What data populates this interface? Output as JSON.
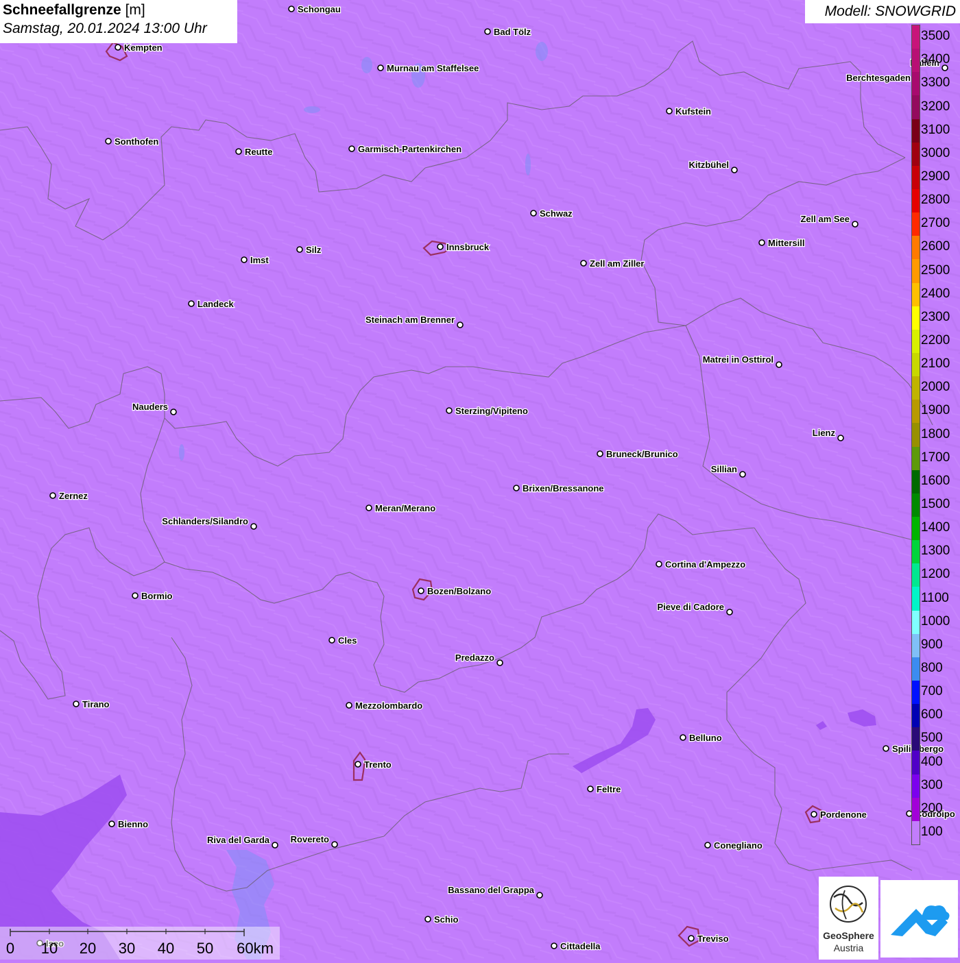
{
  "title": {
    "main": "Schneefallgrenze",
    "unit": "[m]",
    "datetime": "Samstag, 20.01.2024 13:00 Uhr"
  },
  "model_label": "Modell: SNOWGRID",
  "legend": {
    "levels": [
      {
        "value": "3500",
        "color": "#c8147a"
      },
      {
        "value": "3400",
        "color": "#b80f74"
      },
      {
        "value": "3300",
        "color": "#a80a6e"
      },
      {
        "value": "3200",
        "color": "#940a5e"
      },
      {
        "value": "3100",
        "color": "#7a0018"
      },
      {
        "value": "3000",
        "color": "#a00010"
      },
      {
        "value": "2900",
        "color": "#c80008"
      },
      {
        "value": "2800",
        "color": "#e60000"
      },
      {
        "value": "2700",
        "color": "#ff2a00"
      },
      {
        "value": "2600",
        "color": "#ff7a00"
      },
      {
        "value": "2500",
        "color": "#ff9a00"
      },
      {
        "value": "2400",
        "color": "#ffc000"
      },
      {
        "value": "2300",
        "color": "#ffff00"
      },
      {
        "value": "2200",
        "color": "#d8f000"
      },
      {
        "value": "2100",
        "color": "#c8d800"
      },
      {
        "value": "2000",
        "color": "#c0b400"
      },
      {
        "value": "1900",
        "color": "#b89a00"
      },
      {
        "value": "1800",
        "color": "#989000"
      },
      {
        "value": "1700",
        "color": "#5e9a0a"
      },
      {
        "value": "1600",
        "color": "#006a00"
      },
      {
        "value": "1500",
        "color": "#008a00"
      },
      {
        "value": "1400",
        "color": "#00b400"
      },
      {
        "value": "1300",
        "color": "#00d43c"
      },
      {
        "value": "1200",
        "color": "#00e890"
      },
      {
        "value": "1100",
        "color": "#00f5c8"
      },
      {
        "value": "1000",
        "color": "#80ffff"
      },
      {
        "value": "900",
        "color": "#80c0f8"
      },
      {
        "value": "800",
        "color": "#3c8cf0"
      },
      {
        "value": "700",
        "color": "#0010ff"
      },
      {
        "value": "600",
        "color": "#0000b4"
      },
      {
        "value": "500",
        "color": "#2a0a78"
      },
      {
        "value": "400",
        "color": "#5000c8"
      },
      {
        "value": "300",
        "color": "#7c00ee"
      },
      {
        "value": "200",
        "color": "#a200d8"
      },
      {
        "value": "100",
        "color": "#c27dfc"
      }
    ]
  },
  "scale_bar": {
    "labels": [
      "0",
      "10",
      "20",
      "30",
      "40",
      "50",
      "60km"
    ]
  },
  "colors": {
    "base": "#c27dfc",
    "low_area": "#9c4cf0",
    "border": "#6e5f78",
    "city_outline": "#9a3060"
  },
  "logo": {
    "name": "GeoSphere",
    "sub": "Austria"
  },
  "cities": [
    {
      "name": "Schongau",
      "anchor": "start"
    },
    {
      "name": "Bad Tölz",
      "anchor": "start"
    },
    {
      "name": "Kempten",
      "anchor": "start"
    },
    {
      "name": "Murnau am Staffelsee",
      "anchor": "start"
    },
    {
      "name": "Hallein",
      "anchor": "end"
    },
    {
      "name": "Berchtesgaden",
      "anchor": "end"
    },
    {
      "name": "Kufstein",
      "anchor": "start"
    },
    {
      "name": "Sonthofen",
      "anchor": "start"
    },
    {
      "name": "Reutte",
      "anchor": "start"
    },
    {
      "name": "Garmisch-Partenkirchen",
      "anchor": "start"
    },
    {
      "name": "Kitzbühel",
      "anchor": "end"
    },
    {
      "name": "Schwaz",
      "anchor": "start"
    },
    {
      "name": "Zell am See",
      "anchor": "end"
    },
    {
      "name": "Mittersill",
      "anchor": "start"
    },
    {
      "name": "Innsbruck",
      "anchor": "start"
    },
    {
      "name": "Imst",
      "anchor": "start"
    },
    {
      "name": "Silz",
      "anchor": "start"
    },
    {
      "name": "Zell am Ziller",
      "anchor": "start"
    },
    {
      "name": "Landeck",
      "anchor": "start"
    },
    {
      "name": "Steinach am Brenner",
      "anchor": "end"
    },
    {
      "name": "Matrei in Osttirol",
      "anchor": "end"
    },
    {
      "name": "Nauders",
      "anchor": "end"
    },
    {
      "name": "Sterzing/Vipiteno",
      "anchor": "start"
    },
    {
      "name": "Lienz",
      "anchor": "end"
    },
    {
      "name": "Bruneck/Brunico",
      "anchor": "start"
    },
    {
      "name": "Sillian",
      "anchor": "end"
    },
    {
      "name": "Zernez",
      "anchor": "start"
    },
    {
      "name": "Brixen/Bressanone",
      "anchor": "start"
    },
    {
      "name": "Meran/Merano",
      "anchor": "start"
    },
    {
      "name": "Schlanders/Silandro",
      "anchor": "end"
    },
    {
      "name": "Cortina d'Ampezzo",
      "anchor": "start"
    },
    {
      "name": "Bozen/Bolzano",
      "anchor": "start"
    },
    {
      "name": "Bormio",
      "anchor": "start"
    },
    {
      "name": "Pieve di Cadore",
      "anchor": "end"
    },
    {
      "name": "Cles",
      "anchor": "start"
    },
    {
      "name": "Predazzo",
      "anchor": "end"
    },
    {
      "name": "Tirano",
      "anchor": "start"
    },
    {
      "name": "Mezzolombardo",
      "anchor": "start"
    },
    {
      "name": "Belluno",
      "anchor": "start"
    },
    {
      "name": "Spilimbergo",
      "anchor": "start"
    },
    {
      "name": "Trento",
      "anchor": "start"
    },
    {
      "name": "Feltre",
      "anchor": "start"
    },
    {
      "name": "Pordenone",
      "anchor": "start"
    },
    {
      "name": "Codroipo",
      "anchor": "start"
    },
    {
      "name": "Bienno",
      "anchor": "start"
    },
    {
      "name": "Riva del Garda",
      "anchor": "end"
    },
    {
      "name": "Rovereto",
      "anchor": "end"
    },
    {
      "name": "Conegliano",
      "anchor": "start"
    },
    {
      "name": "Bassano del Grappa",
      "anchor": "end"
    },
    {
      "name": "Schio",
      "anchor": "start"
    },
    {
      "name": "Iseo",
      "anchor": "start"
    },
    {
      "name": "Treviso",
      "anchor": "start"
    },
    {
      "name": "Cittadella",
      "anchor": "start"
    }
  ]
}
